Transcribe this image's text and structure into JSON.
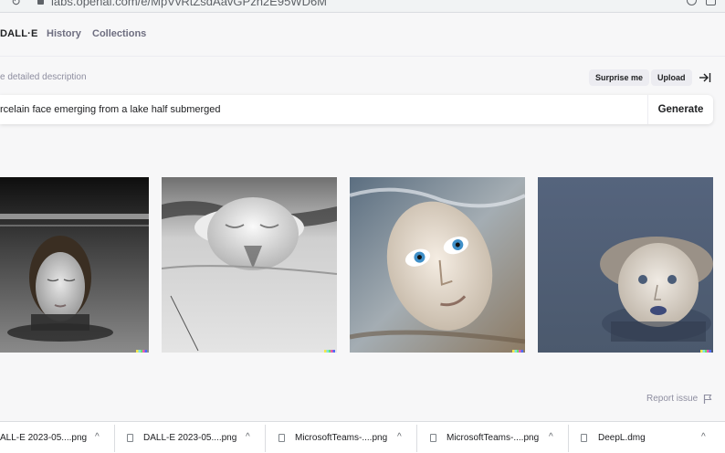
{
  "browser": {
    "url": "labs.openai.com/e/MpVvRtZsdAavGPzh2E95WD6M"
  },
  "nav": {
    "brand": "DALL·E",
    "links": [
      "History",
      "Collections"
    ]
  },
  "prompt": {
    "hint": "e detailed description",
    "surprise_label": "Surprise me",
    "upload_label": "Upload",
    "text": "rcelain face emerging from a lake half submerged",
    "generate_label": "Generate"
  },
  "results": {
    "images": [
      {
        "name": "porcelain-face-dark-lake"
      },
      {
        "name": "porcelain-face-grey-water"
      },
      {
        "name": "porcelain-face-blue-eyes"
      },
      {
        "name": "porcelain-face-curly-hair"
      }
    ]
  },
  "report": {
    "label": "Report issue"
  },
  "downloads": [
    {
      "name": "ALL-E 2023-05....png"
    },
    {
      "name": "DALL-E 2023-05....png"
    },
    {
      "name": "MicrosoftTeams-....png"
    },
    {
      "name": "MicrosoftTeams-....png"
    },
    {
      "name": "DeepL.dmg"
    }
  ],
  "colors": {
    "background": "#f7f7f8",
    "text": "#202123",
    "muted": "#8e8ea0",
    "pill": "#ececf1"
  }
}
